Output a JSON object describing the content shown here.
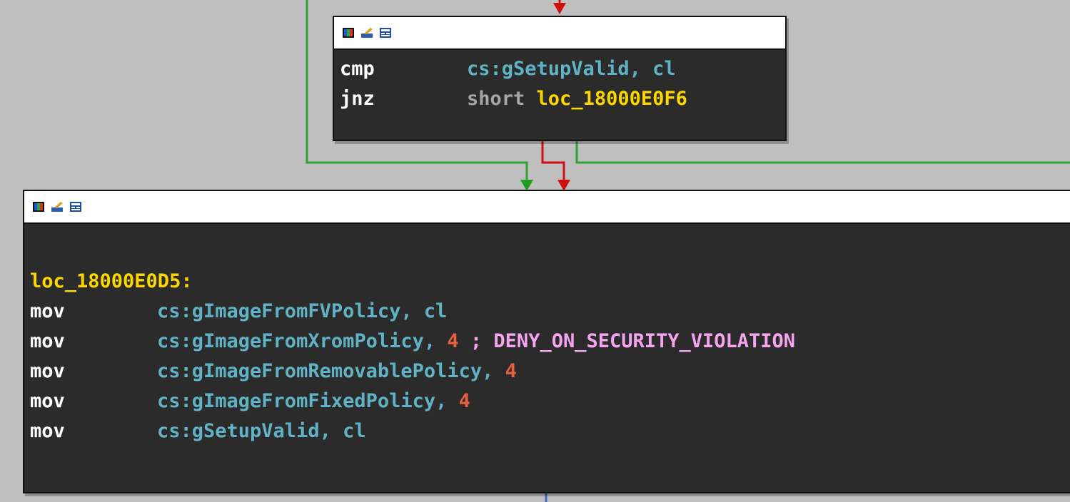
{
  "colors": {
    "background": "#bfbfbf",
    "node_bg": "#2b2b2b",
    "edge_true": "#2fa12f",
    "edge_false": "#d01010",
    "edge_plain": "#3c6fb7",
    "mnemonic": "#ffffff",
    "register": "#5fb3c4",
    "label": "#ffd700",
    "number": "#e8603c",
    "comment": "#f7a4f0",
    "keyword": "#a6a6a6"
  },
  "toolbar_icons": [
    "color-palette-icon",
    "rename-icon",
    "graph-view-icon"
  ],
  "node_top": {
    "lines": [
      {
        "mnemonic": "cmp",
        "operand": "cs:gSetupValid",
        "sep": ", ",
        "arg": "cl"
      },
      {
        "mnemonic": "jnz",
        "keyword": "short ",
        "target": "loc_18000E0F6"
      }
    ]
  },
  "node_bottom": {
    "label": "loc_18000E0D5:",
    "lines": [
      {
        "mnemonic": "mov",
        "operand": "cs:gImageFromFVPolicy",
        "sep": ", ",
        "arg": "cl",
        "arg_kind": "reg",
        "comment": ""
      },
      {
        "mnemonic": "mov",
        "operand": "cs:gImageFromXromPolicy",
        "sep": ", ",
        "arg": "4",
        "arg_kind": "num",
        "comment": " ; DENY_ON_SECURITY_VIOLATION"
      },
      {
        "mnemonic": "mov",
        "operand": "cs:gImageFromRemovablePolicy",
        "sep": ", ",
        "arg": "4",
        "arg_kind": "num",
        "comment": ""
      },
      {
        "mnemonic": "mov",
        "operand": "cs:gImageFromFixedPolicy",
        "sep": ", ",
        "arg": "4",
        "arg_kind": "num",
        "comment": ""
      },
      {
        "mnemonic": "mov",
        "operand": "cs:gSetupValid",
        "sep": ", ",
        "arg": "cl",
        "arg_kind": "reg",
        "comment": ""
      }
    ]
  }
}
